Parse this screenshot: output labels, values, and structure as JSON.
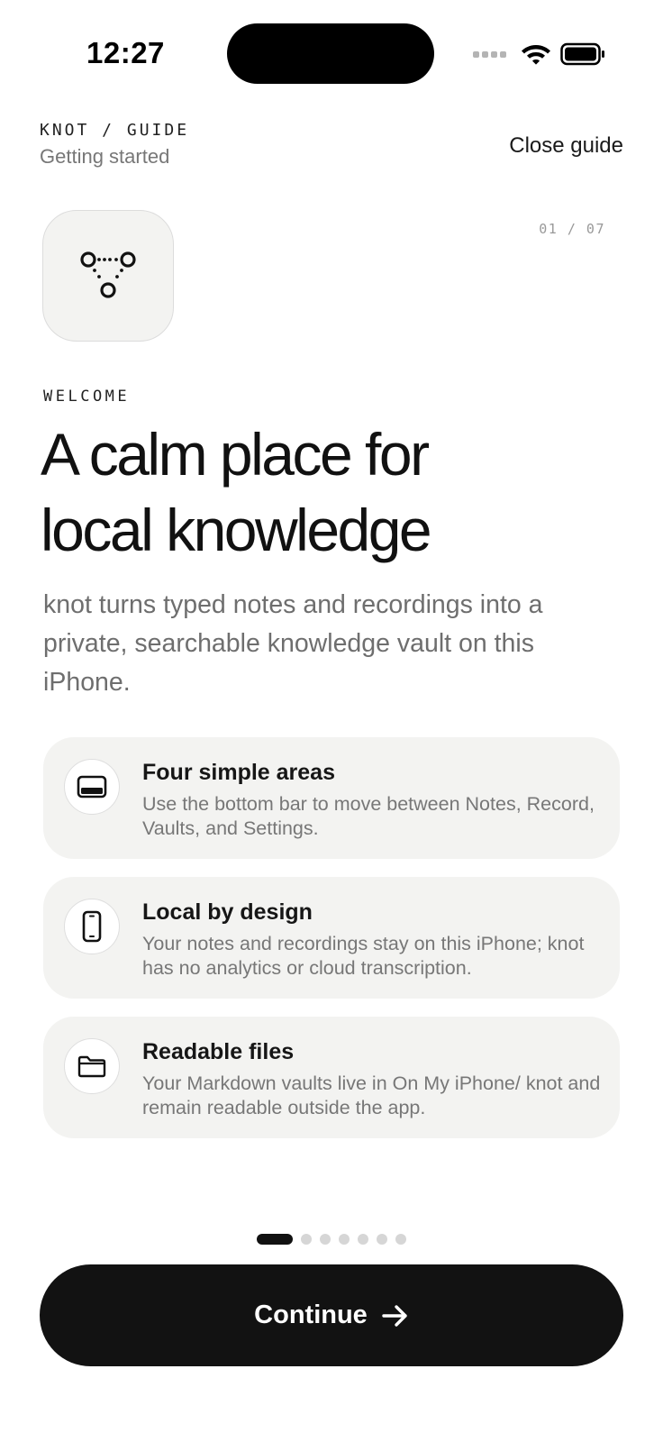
{
  "status_bar": {
    "time": "12:27"
  },
  "header": {
    "breadcrumb": "KNOT / GUIDE",
    "subtitle": "Getting started",
    "close_label": "Close guide"
  },
  "step": {
    "counter": "01 / 07",
    "current": 1,
    "total": 7,
    "eyebrow": "WELCOME",
    "headline_line1": "A calm place for",
    "headline_line2": "local knowledge",
    "description": "knot turns typed notes and recordings into a private, searchable knowledge vault on this iPhone."
  },
  "features": [
    {
      "icon": "bottom-bar-icon",
      "title": "Four simple areas",
      "description": "Use the bottom bar to move between Notes, Record, Vaults, and Settings."
    },
    {
      "icon": "phone-icon",
      "title": "Local by design",
      "description": "Your notes and recordings stay on this iPhone; knot has no analytics or cloud transcription."
    },
    {
      "icon": "folder-icon",
      "title": "Readable files",
      "description": "Your Markdown vaults live in On My iPhone/ knot and remain readable outside the app."
    }
  ],
  "actions": {
    "continue_label": "Continue"
  },
  "colors": {
    "primary": "#121212",
    "card_background": "#f3f3f1",
    "muted_text": "#777777",
    "inactive_dot": "#d6d6d6"
  }
}
